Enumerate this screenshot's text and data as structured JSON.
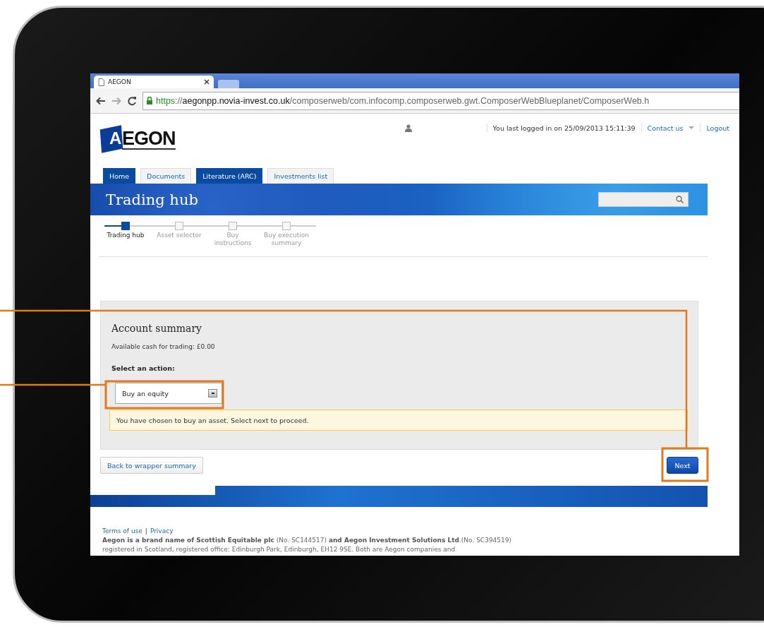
{
  "browser": {
    "tab_title": "AEGON",
    "address_parts": [
      {
        "kind": "secure",
        "text": "https"
      },
      {
        "kind": "plain",
        "text": "://"
      },
      {
        "kind": "host",
        "text": "aegonpp.novia-invest.co.uk"
      },
      {
        "kind": "plain",
        "text": "/composerweb/com.infocomp.composerweb.gwt.ComposerWebBlueplanet/ComposerWeb.h"
      }
    ]
  },
  "header": {
    "logo_mark": "A",
    "logo": "EGON",
    "last_login": "You last logged in on 25/09/2013 15:11:39",
    "links": [
      "Contact us",
      "Logout"
    ]
  },
  "nav_tabs": [
    {
      "label": "Home",
      "selected": true
    },
    {
      "label": "Documents",
      "selected": false
    },
    {
      "label": "Literature (ARC)",
      "selected": true
    },
    {
      "label": "Investments list",
      "selected": false
    }
  ],
  "banner": {
    "title": "Trading hub"
  },
  "steps": [
    {
      "label": "Trading hub",
      "selected": true
    },
    {
      "label": "Asset selector",
      "selected": false
    },
    {
      "label": "Buy instructions",
      "selected": false
    },
    {
      "label": "Buy execution summary",
      "selected": false
    }
  ],
  "panel": {
    "title": "Account summary",
    "cash": "Available cash for trading: £0.00",
    "action_label": "Select an action:",
    "action_value": "Buy an equity",
    "message": "You have chosen to buy an asset. Select next to proceed."
  },
  "buttons": {
    "back": "Back to wrapper summary",
    "next": "Next"
  },
  "footer": {
    "links": [
      "Terms of use",
      "Privacy"
    ],
    "separator": "|",
    "legal": "**Aegon is a brand name of Scottish Equitable plc** (No. SC144517) **and Aegon Investment Solutions Ltd**.(No. SC394519) registered in Scotland, registered office: Edinburgh Park, Edinburgh, EH12 9SE. Both are Aegon companies and"
  }
}
